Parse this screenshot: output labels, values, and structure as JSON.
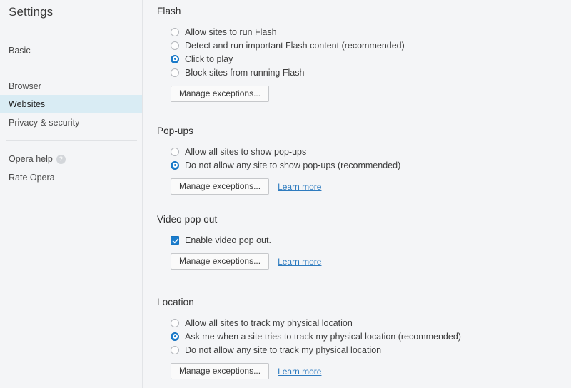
{
  "sidebar": {
    "title": "Settings",
    "items": [
      {
        "label": "Basic",
        "selected": false
      },
      {
        "label": "Browser",
        "selected": false
      },
      {
        "label": "Websites",
        "selected": true
      },
      {
        "label": "Privacy & security",
        "selected": false
      }
    ],
    "footer_items": [
      {
        "label": "Opera help",
        "icon": "help-circle-icon"
      },
      {
        "label": "Rate Opera"
      }
    ],
    "help_icon_glyph": "?",
    "selected_background": "#d9ecf4"
  },
  "colors": {
    "page_background": "#f4f5f7",
    "accent": "#1a7ccd",
    "link": "#2e7bbf",
    "border": "#c6c8cb"
  },
  "sections": {
    "flash": {
      "title": "Flash",
      "options": [
        {
          "label": "Allow sites to run Flash",
          "checked": false
        },
        {
          "label": "Detect and run important Flash content (recommended)",
          "checked": false
        },
        {
          "label": "Click to play",
          "checked": true
        },
        {
          "label": "Block sites from running Flash",
          "checked": false
        }
      ],
      "button_label": "Manage exceptions...",
      "link_label": ""
    },
    "popups": {
      "title": "Pop-ups",
      "options": [
        {
          "label": "Allow all sites to show pop-ups",
          "checked": false
        },
        {
          "label": "Do not allow any site to show pop-ups (recommended)",
          "checked": true
        }
      ],
      "button_label": "Manage exceptions...",
      "link_label": "Learn more"
    },
    "video": {
      "title": "Video pop out",
      "checkbox_label": "Enable video pop out.",
      "checkbox_checked": true,
      "button_label": "Manage exceptions...",
      "link_label": "Learn more"
    },
    "location": {
      "title": "Location",
      "options": [
        {
          "label": "Allow all sites to track my physical location",
          "checked": false
        },
        {
          "label": "Ask me when a site tries to track my physical location (recommended)",
          "checked": true
        },
        {
          "label": "Do not allow any site to track my physical location",
          "checked": false
        }
      ],
      "button_label": "Manage exceptions...",
      "link_label": "Learn more"
    }
  }
}
